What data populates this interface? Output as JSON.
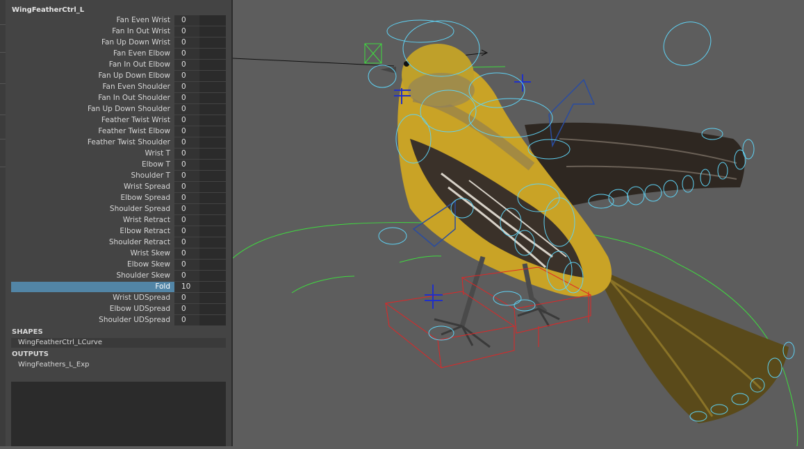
{
  "panel": {
    "title": "WingFeatherCtrl_L",
    "attributes": [
      {
        "label": "Fan Even Wrist",
        "value": "0"
      },
      {
        "label": "Fan In Out Wrist",
        "value": "0"
      },
      {
        "label": "Fan Up Down Wrist",
        "value": "0"
      },
      {
        "label": "Fan Even Elbow",
        "value": "0"
      },
      {
        "label": "Fan In Out Elbow",
        "value": "0"
      },
      {
        "label": "Fan Up Down Elbow",
        "value": "0"
      },
      {
        "label": "Fan Even Shoulder",
        "value": "0"
      },
      {
        "label": "Fan In Out Shoulder",
        "value": "0"
      },
      {
        "label": "Fan Up Down Shoulder",
        "value": "0"
      },
      {
        "label": "Feather Twist Wrist",
        "value": "0"
      },
      {
        "label": "Feather Twist Elbow",
        "value": "0"
      },
      {
        "label": "Feather Twist Shoulder",
        "value": "0"
      },
      {
        "label": "Wrist T",
        "value": "0"
      },
      {
        "label": "Elbow T",
        "value": "0"
      },
      {
        "label": "Shoulder T",
        "value": "0"
      },
      {
        "label": "Wrist Spread",
        "value": "0"
      },
      {
        "label": "Elbow Spread",
        "value": "0"
      },
      {
        "label": "Shoulder Spread",
        "value": "0"
      },
      {
        "label": "Wrist Retract",
        "value": "0"
      },
      {
        "label": "Elbow Retract",
        "value": "0"
      },
      {
        "label": "Shoulder Retract",
        "value": "0"
      },
      {
        "label": "Wrist Skew",
        "value": "0"
      },
      {
        "label": "Elbow Skew",
        "value": "0"
      },
      {
        "label": "Shoulder Skew",
        "value": "0"
      },
      {
        "label": "Fold",
        "value": "10",
        "selected": true
      },
      {
        "label": "Wrist UDSpread",
        "value": "0"
      },
      {
        "label": "Elbow UDSpread",
        "value": "0"
      },
      {
        "label": "Shoulder UDSpread",
        "value": "0"
      }
    ],
    "shapes_heading": "SHAPES",
    "shapes_item": "WingFeatherCtrl_LCurve",
    "outputs_heading": "OUTPUTS",
    "outputs_item": "WingFeathers_L_Exp"
  },
  "colors": {
    "panel_bg": "#444444",
    "field_bg": "#2b2b2b",
    "selected_bg": "#5285a6",
    "viewport_bg": "#5d5d5d",
    "curve_cyan": "#5fd3f5",
    "curve_green": "#3fdc3f",
    "curve_red": "#e02626",
    "curve_blue": "#2030c8",
    "bird_yellow": "#c9a326",
    "bird_dark": "#2e2721"
  }
}
